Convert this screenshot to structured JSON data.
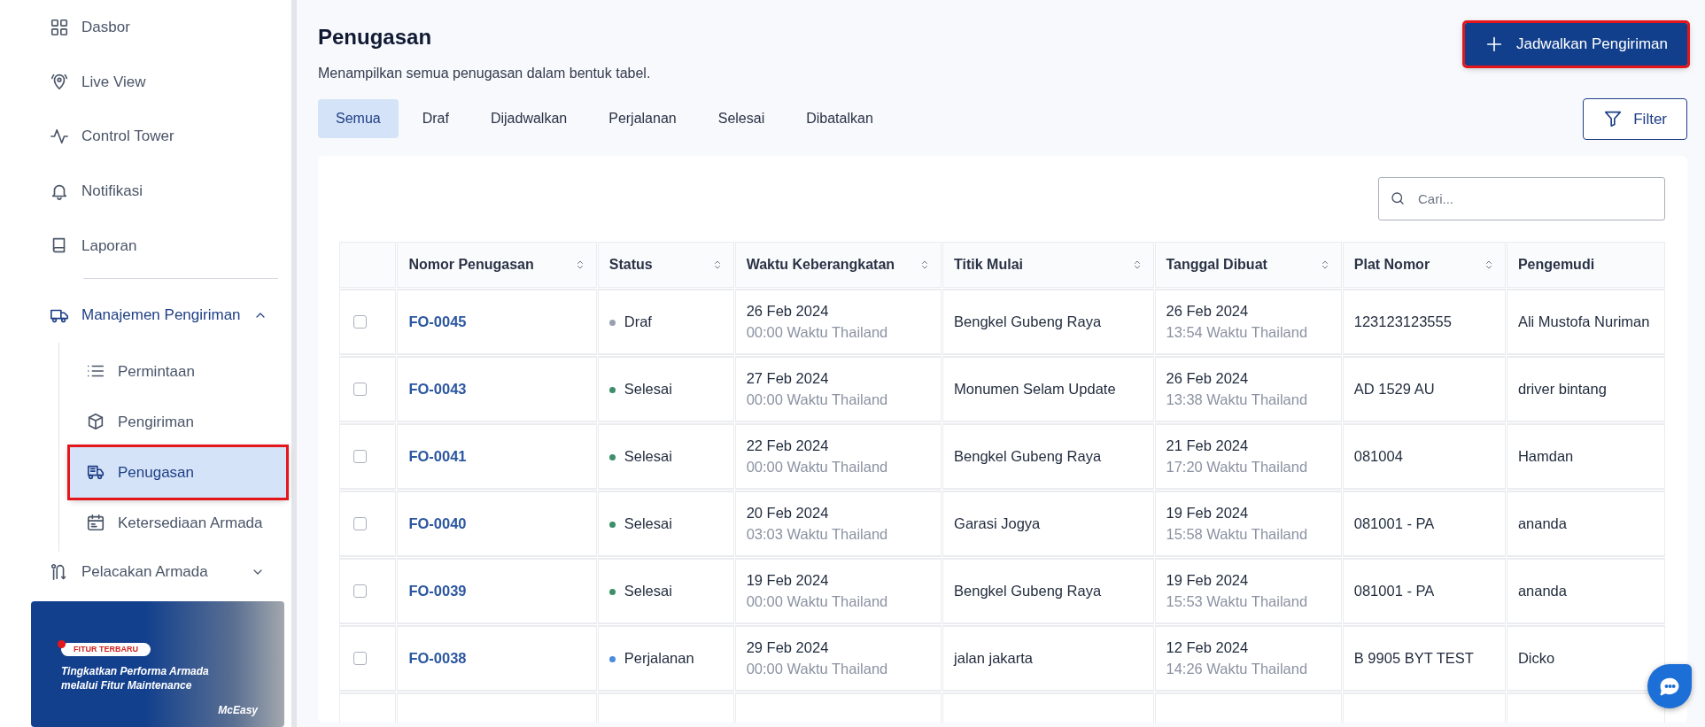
{
  "sidebar": {
    "items": [
      {
        "kind": "item",
        "label": "Dasbor",
        "selected": false
      },
      {
        "kind": "item",
        "label": "Live View",
        "selected": false
      },
      {
        "kind": "item",
        "label": "Control Tower",
        "selected": false
      },
      {
        "kind": "item",
        "label": "Notifikasi",
        "selected": false
      },
      {
        "kind": "item",
        "label": "Laporan",
        "selected": false
      },
      {
        "kind": "group",
        "label": "Manajemen Pengiriman",
        "expanded": true,
        "children": [
          {
            "label": "Permintaan",
            "selected": false,
            "highlighted": false
          },
          {
            "label": "Pengiriman",
            "selected": false,
            "highlighted": false
          },
          {
            "label": "Penugasan",
            "selected": true,
            "highlighted": true
          },
          {
            "label": "Ketersediaan Armada",
            "selected": false,
            "highlighted": false
          }
        ]
      },
      {
        "kind": "group",
        "label": "Pelacakan Armada",
        "expanded": false
      }
    ],
    "banner": {
      "tag": "FITUR TERBARU",
      "text": "Tingkatkan Performa Armada melalui Fitur Maintenance",
      "logo": "McEasy"
    }
  },
  "page": {
    "title": "Penugasan",
    "subtitle": "Menampilkan semua penugasan dalam bentuk tabel.",
    "primary_button": {
      "label": "Jadwalkan Pengiriman",
      "highlighted": true
    },
    "tabs": [
      {
        "label": "Semua",
        "selected": true
      },
      {
        "label": "Draf",
        "selected": false
      },
      {
        "label": "Dijadwalkan",
        "selected": false
      },
      {
        "label": "Perjalanan",
        "selected": false
      },
      {
        "label": "Selesai",
        "selected": false
      },
      {
        "label": "Dibatalkan",
        "selected": false
      }
    ],
    "filter_button": "Filter",
    "search": {
      "placeholder": "Cari..."
    }
  },
  "table": {
    "columns": [
      {
        "label": "Nomor Penugasan",
        "sortable": true
      },
      {
        "label": "Status",
        "sortable": true
      },
      {
        "label": "Waktu Keberangkatan",
        "sortable": true
      },
      {
        "label": "Titik Mulai",
        "sortable": true
      },
      {
        "label": "Tanggal Dibuat",
        "sortable": true
      },
      {
        "label": "Plat Nomor",
        "sortable": true
      },
      {
        "label": "Pengemudi",
        "sortable": false
      }
    ],
    "rows": [
      {
        "checked": false,
        "id": "FO-0045",
        "status": "Draf",
        "color": "#9aa1ae",
        "depart_date": "26 Feb 2024",
        "depart_time": "00:00 Waktu Thailand",
        "start": "Bengkel Gubeng Raya",
        "created_date": "26 Feb 2024",
        "created_time": "13:54 Waktu Thailand",
        "plate": "123123123555",
        "driver": "Ali Mustofa Nuriman"
      },
      {
        "checked": false,
        "id": "FO-0043",
        "status": "Selesai",
        "color": "#3d8f6a",
        "depart_date": "27 Feb 2024",
        "depart_time": "00:00 Waktu Thailand",
        "start": "Monumen Selam Update",
        "created_date": "26 Feb 2024",
        "created_time": "13:38 Waktu Thailand",
        "plate": "AD 1529 AU",
        "driver": "driver bintang"
      },
      {
        "checked": false,
        "id": "FO-0041",
        "status": "Selesai",
        "color": "#3d8f6a",
        "depart_date": "22 Feb 2024",
        "depart_time": "00:00 Waktu Thailand",
        "start": "Bengkel Gubeng Raya",
        "created_date": "21 Feb 2024",
        "created_time": "17:20 Waktu Thailand",
        "plate": "081004",
        "driver": "Hamdan"
      },
      {
        "checked": false,
        "id": "FO-0040",
        "status": "Selesai",
        "color": "#3d8f6a",
        "depart_date": "20 Feb 2024",
        "depart_time": "03:03 Waktu Thailand",
        "start": "Garasi Jogya",
        "created_date": "19 Feb 2024",
        "created_time": "15:58 Waktu Thailand",
        "plate": "081001 - PA",
        "driver": "ananda"
      },
      {
        "checked": false,
        "id": "FO-0039",
        "status": "Selesai",
        "color": "#3d8f6a",
        "depart_date": "19 Feb 2024",
        "depart_time": "00:00 Waktu Thailand",
        "start": "Bengkel Gubeng Raya",
        "created_date": "19 Feb 2024",
        "created_time": "15:53 Waktu Thailand",
        "plate": "081001 - PA",
        "driver": "ananda"
      },
      {
        "checked": false,
        "id": "FO-0038",
        "status": "Perjalanan",
        "color": "#4a8de0",
        "depart_date": "29 Feb 2024",
        "depart_time": "00:00 Waktu Thailand",
        "start": "jalan jakarta",
        "created_date": "12 Feb 2024",
        "created_time": "14:26 Waktu Thailand",
        "plate": "B 9905 BYT TEST",
        "driver": "Dicko"
      }
    ]
  }
}
